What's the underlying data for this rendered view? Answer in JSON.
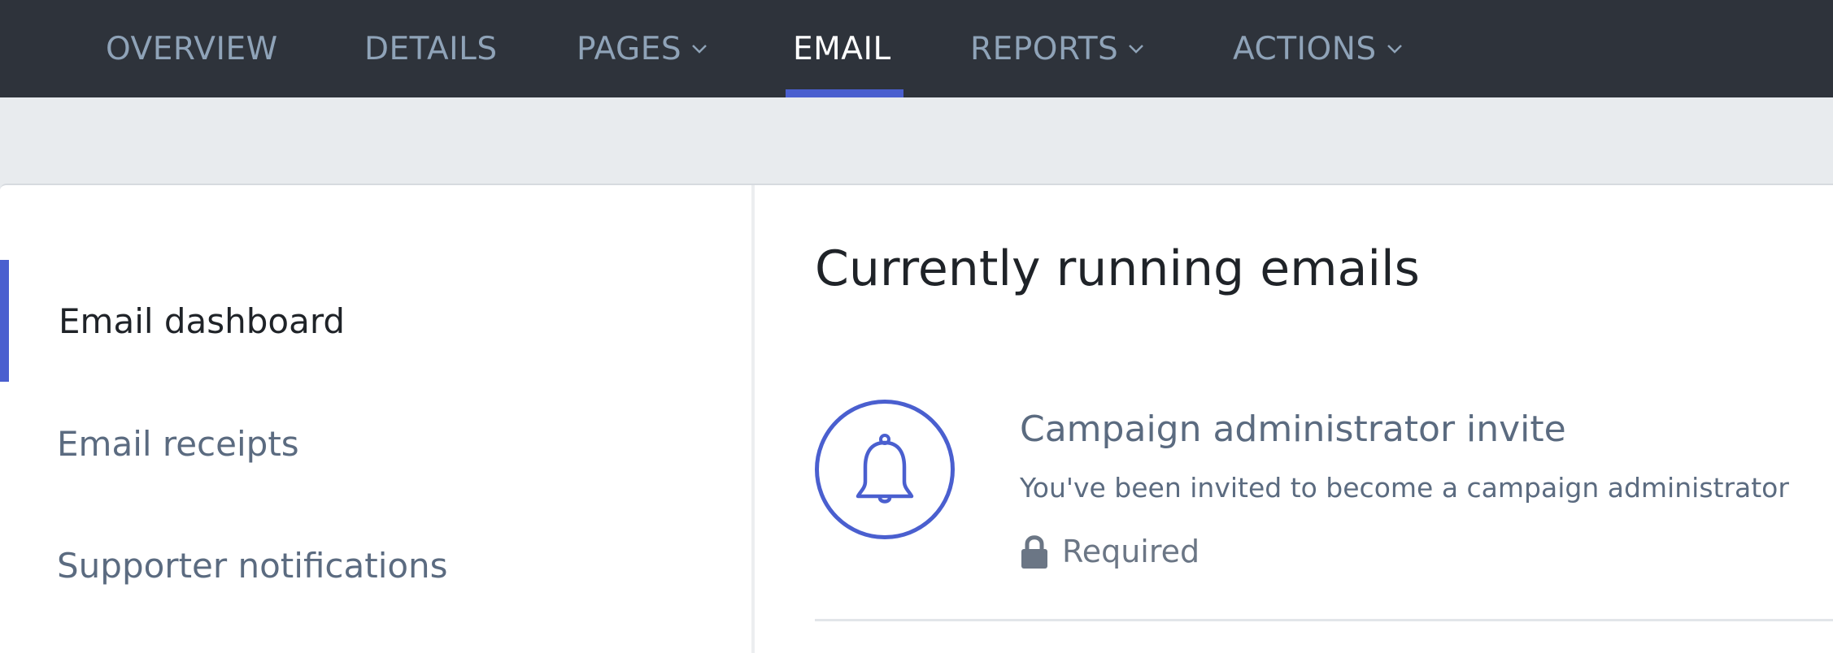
{
  "topnav": {
    "items": [
      {
        "label": "OVERVIEW",
        "has_dropdown": false,
        "active": false
      },
      {
        "label": "DETAILS",
        "has_dropdown": false,
        "active": false
      },
      {
        "label": "PAGES",
        "has_dropdown": true,
        "active": false
      },
      {
        "label": "EMAIL",
        "has_dropdown": false,
        "active": true
      },
      {
        "label": "REPORTS",
        "has_dropdown": true,
        "active": false
      },
      {
        "label": "ACTIONS",
        "has_dropdown": true,
        "active": false
      }
    ]
  },
  "sidebar": {
    "items": [
      {
        "label": "Email dashboard",
        "active": true
      },
      {
        "label": "Email receipts",
        "active": false
      },
      {
        "label": "Supporter notifications",
        "active": false
      }
    ]
  },
  "main": {
    "title": "Currently running emails",
    "emails": [
      {
        "icon": "bell-icon",
        "name": "Campaign administrator invite",
        "description": "You've been invited to become a campaign administrator",
        "status_icon": "lock-icon",
        "status": "Required"
      }
    ]
  },
  "colors": {
    "nav_background": "#2e333b",
    "nav_text": "#8fa3b8",
    "nav_active_text": "#ffffff",
    "accent": "#4a5fcf",
    "page_background": "#e8ebee",
    "card_background": "#ffffff",
    "text_dark": "#1f2328",
    "text_muted": "#5b6b80"
  }
}
